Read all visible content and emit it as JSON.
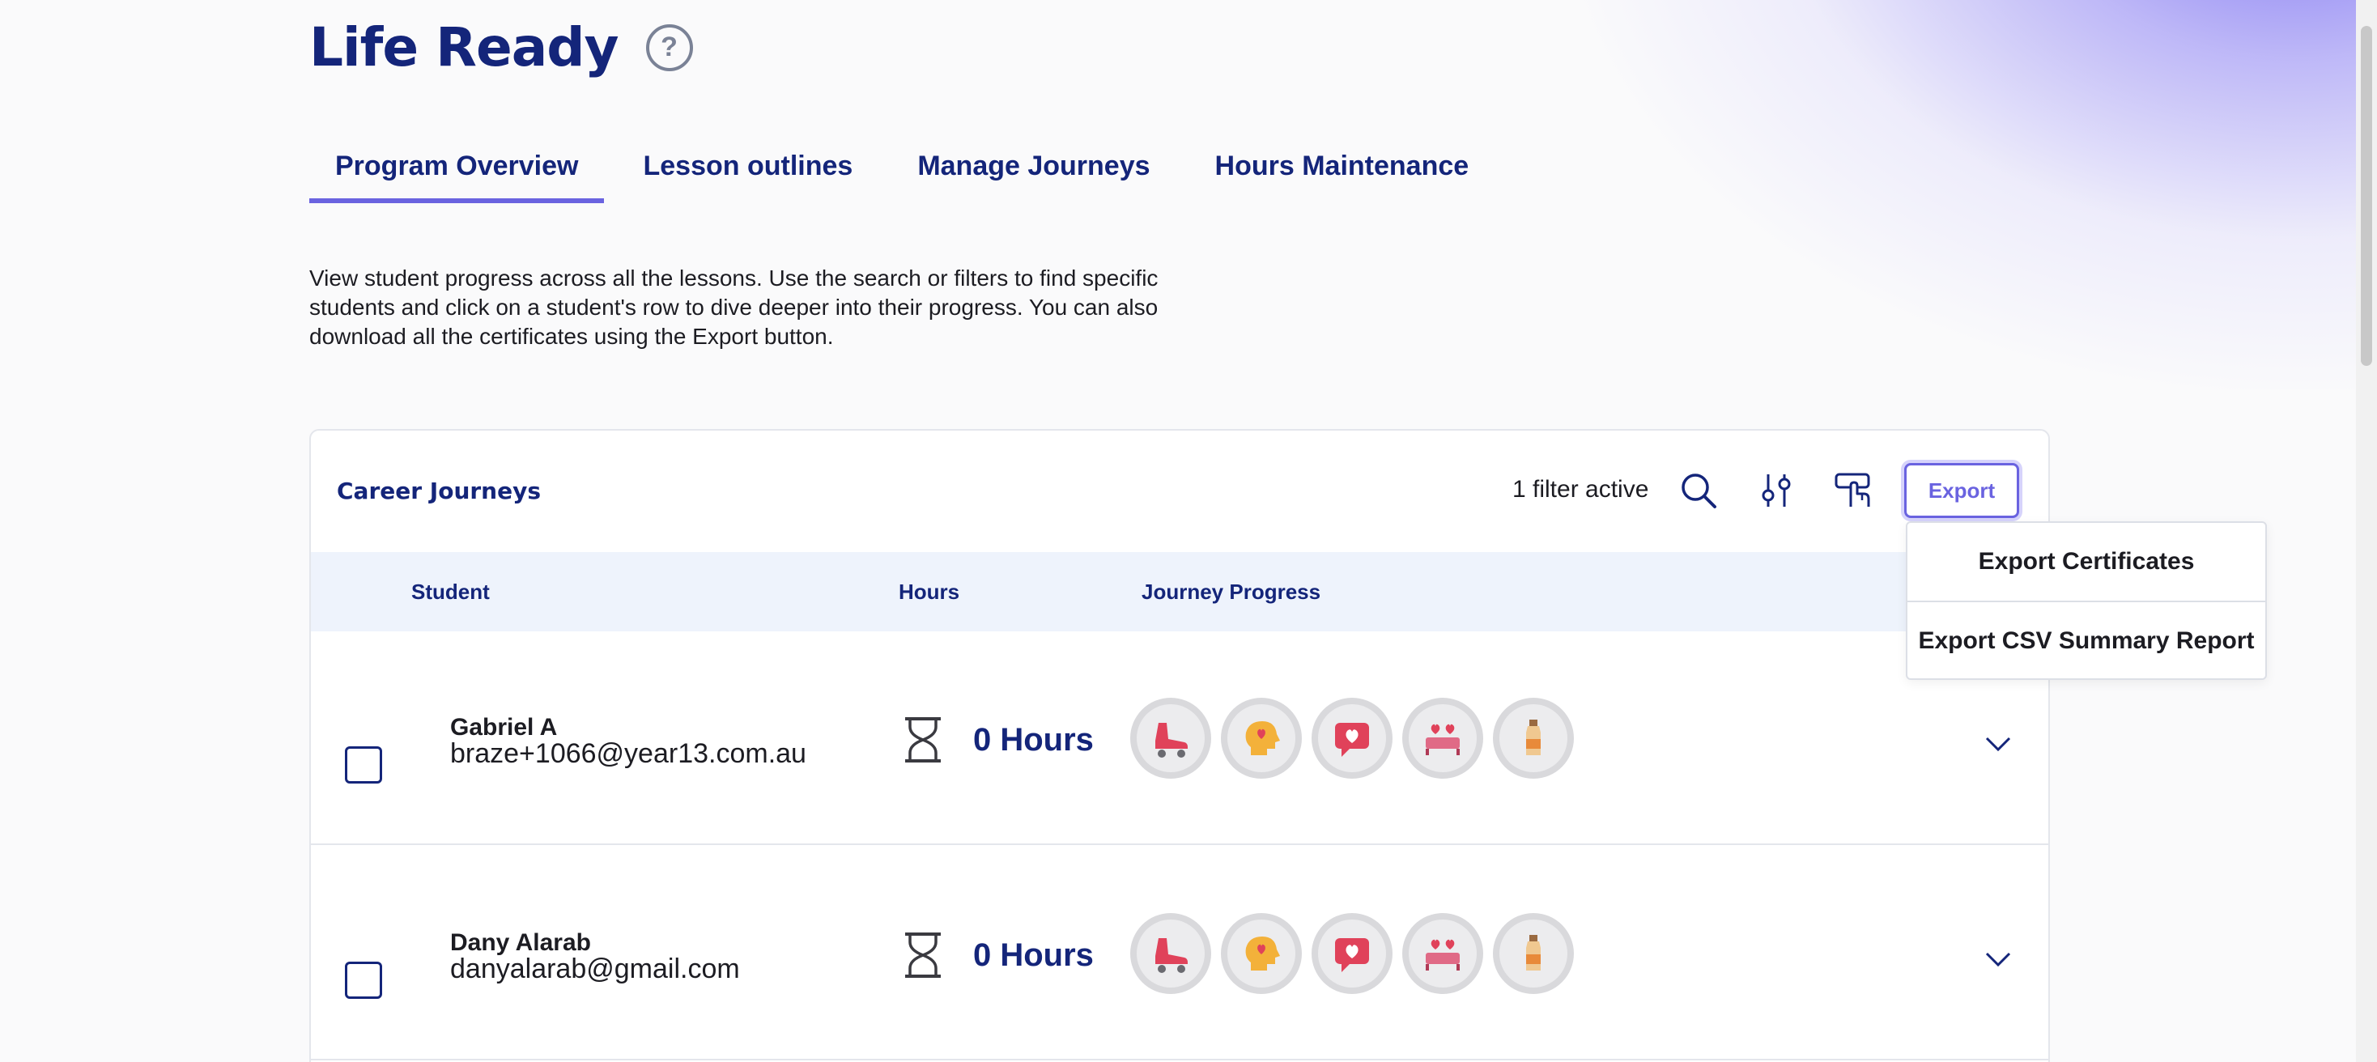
{
  "app": {
    "title": "Life Ready",
    "help_symbol": "?"
  },
  "tabs": [
    {
      "label": "Program Overview",
      "active": true
    },
    {
      "label": "Lesson outlines",
      "active": false
    },
    {
      "label": "Manage Journeys",
      "active": false
    },
    {
      "label": "Hours Maintenance",
      "active": false
    }
  ],
  "intro_text": "View student progress across all the lessons. Use the search or filters to find specific students and click on a student's row to dive deeper into their progress. You can also download all the certificates using the Export button.",
  "card": {
    "title": "Career Journeys",
    "filter_status": "1 filter active",
    "export_label": "Export",
    "toolbar_icons": [
      "search-icon",
      "filter-sliders-icon",
      "select-hand-icon"
    ]
  },
  "table": {
    "headers": {
      "student": "Student",
      "hours": "Hours",
      "progress": "Journey Progress"
    },
    "rows": [
      {
        "name": "Gabriel A",
        "email": "braze+1066@year13.com.au",
        "hours": "0 Hours",
        "badges": [
          "roller-skate-icon",
          "mind-heart-icon",
          "heart-message-icon",
          "heart-bed-icon",
          "bottle-icon"
        ]
      },
      {
        "name": "Dany Alarab",
        "email": "danyalarab@gmail.com",
        "hours": "0 Hours",
        "badges": [
          "roller-skate-icon",
          "mind-heart-icon",
          "heart-message-icon",
          "heart-bed-icon",
          "bottle-icon"
        ]
      }
    ]
  },
  "export_menu": {
    "items": [
      "Export Certificates",
      "Export CSV Summary Report"
    ]
  },
  "colors": {
    "primary_navy": "#14257a",
    "accent_purple": "#6a63e0",
    "table_header_bg": "#eef3fc"
  }
}
